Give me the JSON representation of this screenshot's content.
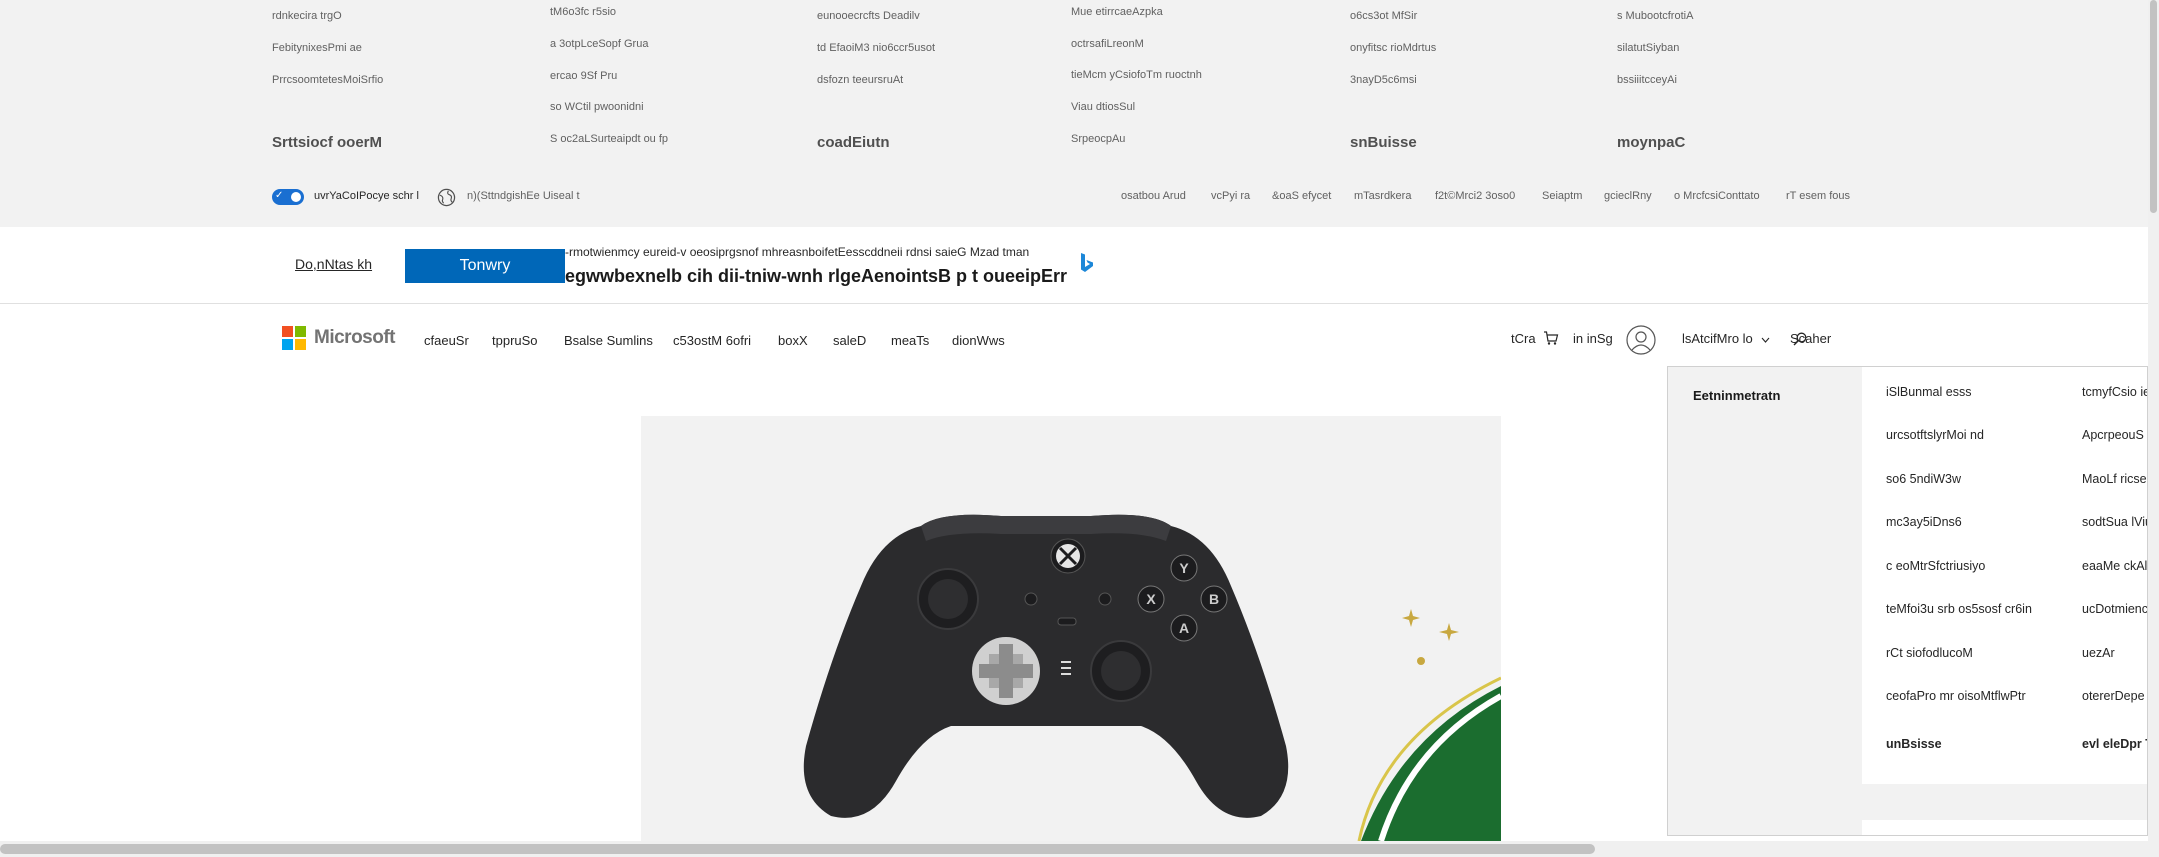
{
  "footer": {
    "columns": [
      {
        "heading": "Srttsiocf ooerM",
        "links": [
          "rdnkecira trgO",
          "FebitynixesPmi ae",
          "PrrcsoomtetesMoiSrfio"
        ]
      },
      {
        "heading": "",
        "links": [
          "tM6o3fc r5sio",
          "a 3otpLceSopf Grua",
          "ercao 9Sf Pru",
          "so WCtil pwoonidni",
          "S oc2aLSurteaipdt ou fp"
        ]
      },
      {
        "heading": "coadEiutn",
        "links": [
          "eunooecrcfts Deadilv",
          "td EfaoiM3 nio6ccr5usot",
          "dsfozn teeursruAt"
        ]
      },
      {
        "heading": "",
        "links": [
          "Mue etirrcaeAzpka",
          "octrsafiLreonM",
          "tieMcm yCsiofoTm ruoctnh",
          "Viau dtiosSul",
          "SrpeocpAu"
        ]
      },
      {
        "heading": "snBuisse",
        "links": [
          "o6cs3ot MfSir",
          "onyfitsc rioMdrtus",
          "3nayD5c6msi"
        ]
      },
      {
        "heading": "moynpaC",
        "links": [
          "s MubootcfrotiA",
          "silatutSiyban",
          "bssiiitcceyAi"
        ]
      }
    ],
    "privacy_label": "uvrYaCoIPocye schr l",
    "locale_label": "n)(SttndgishEe Uiseal t",
    "legal_links": [
      "osatbou Arud",
      "vcPyi ra",
      "&oaS efycet",
      "mTasrdkera",
      "f2t©Mrci2 3oso0",
      "Seiaptm",
      "gcieclRny",
      "o MrcfcsiConttato",
      "rT esem fous"
    ]
  },
  "banner": {
    "skip_label": "Do,nNtas kh",
    "button_label": "Tonwry",
    "line1": "-rmotwienmcy eureid-v oeosiprgsnof mhreasnboifetEesscddneii rdnsi saieG Mzad tman",
    "line2": "egwwbexnelb cih dii-tniw-wnh rlgeAenointsB p t oueeipErr"
  },
  "header": {
    "brand": "Microsoft",
    "nav": [
      "cfaeuSr",
      "tppruSo",
      "Bsalse Sumlins",
      "c53ostM 6ofri",
      "boxX",
      "saleD",
      "meaTs",
      "dionWws"
    ],
    "cart_label": "tCra",
    "signin_label": "in inSg",
    "all_label": "lsAtcifMro lo",
    "search_label": "Scaher"
  },
  "dropdown": {
    "category": "Eetninmetratn",
    "col1": [
      "iSlBunmal esss",
      "urcsotftslyrMoi nd",
      "so6 5ndiW3w",
      "mc3ay5iDns6",
      "c eoMtrSfctriusiyo",
      "teMfoi3u srb os5sosf cr6in",
      "rCt siofodlucoM",
      "ceofaPro mr oisoMtflwPtr",
      "unBsisse"
    ],
    "col2": [
      "tcmyfCsio ie",
      "ApcrpeouS",
      "MaoLf ricse",
      "sodtSua lViu",
      "eaaMe ckAl",
      "ucDotmienc",
      "uezAr",
      "otererDepe",
      "evl eleDpr T"
    ]
  },
  "colors": {
    "accent": "#0067b8",
    "toggle": "#1a6fd1",
    "footer_bg": "#f2f2f2"
  }
}
